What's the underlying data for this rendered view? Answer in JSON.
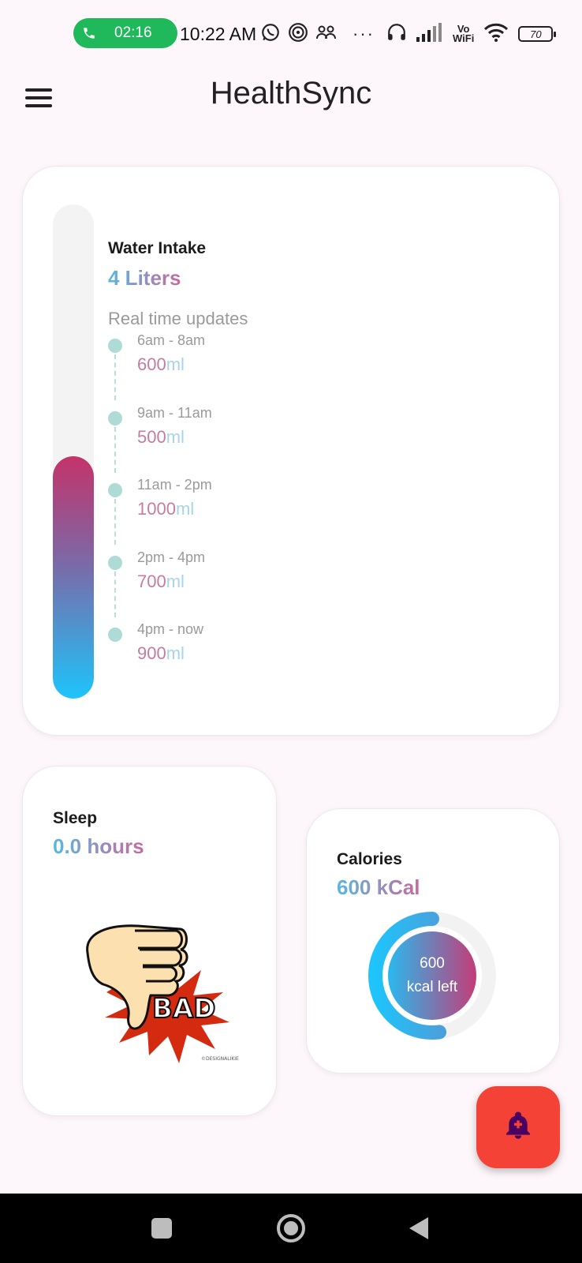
{
  "status_bar": {
    "call_timer": "02:16",
    "time": "10:22 AM",
    "vowifi_top": "Vo",
    "vowifi_bottom": "WiFi",
    "battery": "70",
    "icons": [
      "phone-icon",
      "whatsapp-icon",
      "vpn-icon",
      "people-icon",
      "more-dots-icon",
      "headset-icon",
      "signal-icon",
      "vowifi-icon",
      "wifi-icon",
      "battery-icon"
    ]
  },
  "app_bar": {
    "title": "HealthSync",
    "menu_icon": "hamburger-menu-icon"
  },
  "water": {
    "title": "Water Intake",
    "amount": "4 Liters",
    "updates_label": "Real time updates",
    "fill_fraction": 0.49,
    "entries": [
      {
        "time": "6am - 8am",
        "value": "600",
        "unit": "ml"
      },
      {
        "time": "9am - 11am",
        "value": "500",
        "unit": "ml"
      },
      {
        "time": "11am - 2pm",
        "value": "1000",
        "unit": "ml"
      },
      {
        "time": "2pm - 4pm",
        "value": "700",
        "unit": "ml"
      },
      {
        "time": "4pm - now",
        "value": "900",
        "unit": "ml"
      }
    ]
  },
  "sleep": {
    "title": "Sleep",
    "value": "0.0 hours",
    "image_label": "BAD",
    "image_credit": "©DESIGNALIKIE"
  },
  "calories": {
    "title": "Calories",
    "value": "600 kCal",
    "center_top": "600",
    "center_bottom": "kcal left",
    "progress_fraction": 0.52
  },
  "fab": {
    "icon": "add-alarm-bell-icon"
  },
  "nav": {
    "icons": [
      "recents-square-icon",
      "home-circle-icon",
      "back-triangle-icon"
    ]
  },
  "colors": {
    "background": "#fdf7fb",
    "call_green": "#1fb85a",
    "fab_red": "#f44336",
    "gradient_pink": "#c4336a",
    "gradient_blue": "#1ec4fb",
    "timeline_dot": "#aedbd5"
  }
}
